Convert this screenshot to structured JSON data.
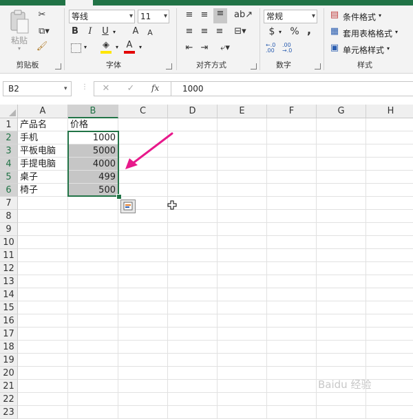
{
  "ribbon": {
    "clipboard": {
      "paste_label": "粘贴",
      "group_label": "剪贴板"
    },
    "font": {
      "font_name": "等线",
      "font_size": "11",
      "bold": "B",
      "italic": "I",
      "underline": "U",
      "grow": "A",
      "shrink": "A",
      "font_color_glyph": "A",
      "group_label": "字体",
      "highlight_color": "#ffe600",
      "font_color": "#e30000"
    },
    "alignment": {
      "group_label": "对齐方式"
    },
    "number": {
      "format": "常规",
      "currency": "$",
      "percent": "%",
      "comma": ",",
      "inc_decimal": "←.0\n.00",
      "dec_decimal": ".00\n→.0",
      "group_label": "数字"
    },
    "styles": {
      "conditional": "条件格式",
      "table": "套用表格格式",
      "cell": "单元格样式",
      "group_label": "样式"
    }
  },
  "formula_bar": {
    "name_box": "B2",
    "fx": "fx",
    "value": "1000"
  },
  "columns": [
    "A",
    "B",
    "C",
    "D",
    "E",
    "F",
    "G",
    "H"
  ],
  "rows": [
    "1",
    "2",
    "3",
    "4",
    "5",
    "6",
    "7",
    "8",
    "9",
    "10",
    "11",
    "12",
    "13",
    "14",
    "15",
    "16",
    "17",
    "18",
    "19",
    "20",
    "21",
    "22",
    "23"
  ],
  "table": {
    "header": [
      "产品名",
      "价格"
    ],
    "rows": [
      [
        "手机",
        "1000"
      ],
      [
        "平板电脑",
        "5000"
      ],
      [
        "手提电脑",
        "4000"
      ],
      [
        "桌子",
        "499"
      ],
      [
        "椅子",
        "500"
      ]
    ]
  },
  "colors": {
    "accent": "#217346",
    "arrow": "#e8198b",
    "selection_fill": "#c6c6c6"
  },
  "watermark": "Baidu 经验"
}
